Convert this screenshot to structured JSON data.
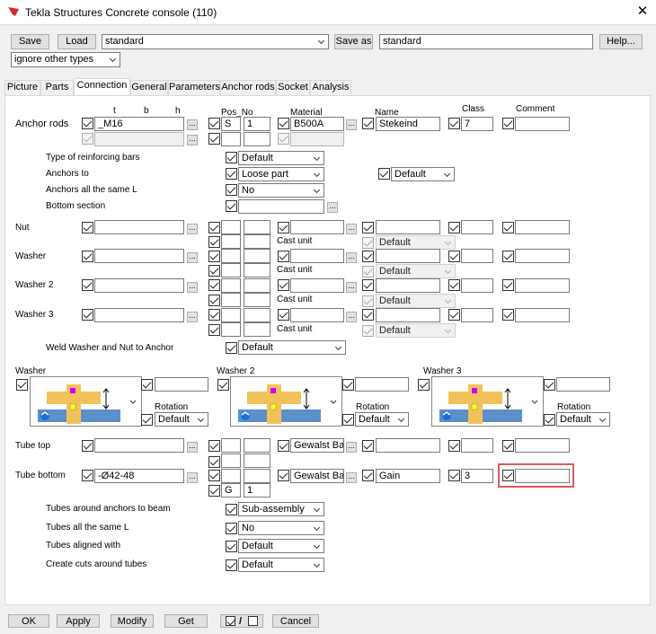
{
  "window": {
    "title": "Tekla Structures  Concrete console (110)"
  },
  "toolbar": {
    "save": "Save",
    "load": "Load",
    "preset": "standard",
    "save_as": "Save as",
    "save_as_name": "standard",
    "help": "Help...",
    "filter": "ignore other types"
  },
  "tabs": [
    "Picture",
    "Parts",
    "Connection",
    "General",
    "Parameters",
    "Anchor rods",
    "Socket",
    "Analysis"
  ],
  "headers": {
    "t": "t",
    "b": "b",
    "h": "h",
    "pos_no": "Pos_No",
    "material": "Material",
    "name": "Name",
    "class": "Class",
    "comment": "Comment"
  },
  "anchor_rods": {
    "label": "Anchor rods",
    "profile": "_M16",
    "pos_prefix": "S",
    "pos_start": "1",
    "material": "B500A",
    "name": "Stekeind",
    "class": "7"
  },
  "options": {
    "reinforcing": {
      "label": "Type of reinforcing bars",
      "value": "Default"
    },
    "anchors_to": {
      "label": "Anchors to",
      "value": "Loose part",
      "value2": "Default"
    },
    "same_l": {
      "label": "Anchors all the same L",
      "value": "No"
    },
    "bottom": {
      "label": "Bottom section"
    }
  },
  "parts": {
    "nut": "Nut",
    "washer": "Washer",
    "washer2": "Washer 2",
    "washer3": "Washer 3",
    "cast_unit": "Cast unit",
    "default": "Default"
  },
  "weld": {
    "label": "Weld Washer and Nut to Anchor",
    "value": "Default"
  },
  "washer_pics": [
    {
      "label": "Washer",
      "rotation_label": "Rotation",
      "rotation": "Default"
    },
    {
      "label": "Washer 2",
      "rotation_label": "Rotation",
      "rotation": "Default"
    },
    {
      "label": "Washer 3",
      "rotation_label": "Rotation",
      "rotation": "Default"
    }
  ],
  "tube_top": {
    "label": "Tube top",
    "material": "Gewalst Band"
  },
  "tube_bottom": {
    "label": "Tube bottom",
    "profile": "-Ø42-48",
    "pos_prefix": "G",
    "pos_start": "1",
    "material": "Gewalst Band",
    "name": "Gain",
    "class": "3"
  },
  "tube_opts": {
    "around": {
      "label": "Tubes around anchors to beam",
      "value": "Sub-assembly"
    },
    "same_l": {
      "label": "Tubes all the same L",
      "value": "No"
    },
    "aligned": {
      "label": "Tubes aligned with",
      "value": "Default"
    },
    "cuts": {
      "label": "Create cuts around tubes",
      "value": "Default"
    }
  },
  "buttons": {
    "ok": "OK",
    "apply": "Apply",
    "modify": "Modify",
    "get": "Get",
    "toggle": "/",
    "cancel": "Cancel"
  }
}
